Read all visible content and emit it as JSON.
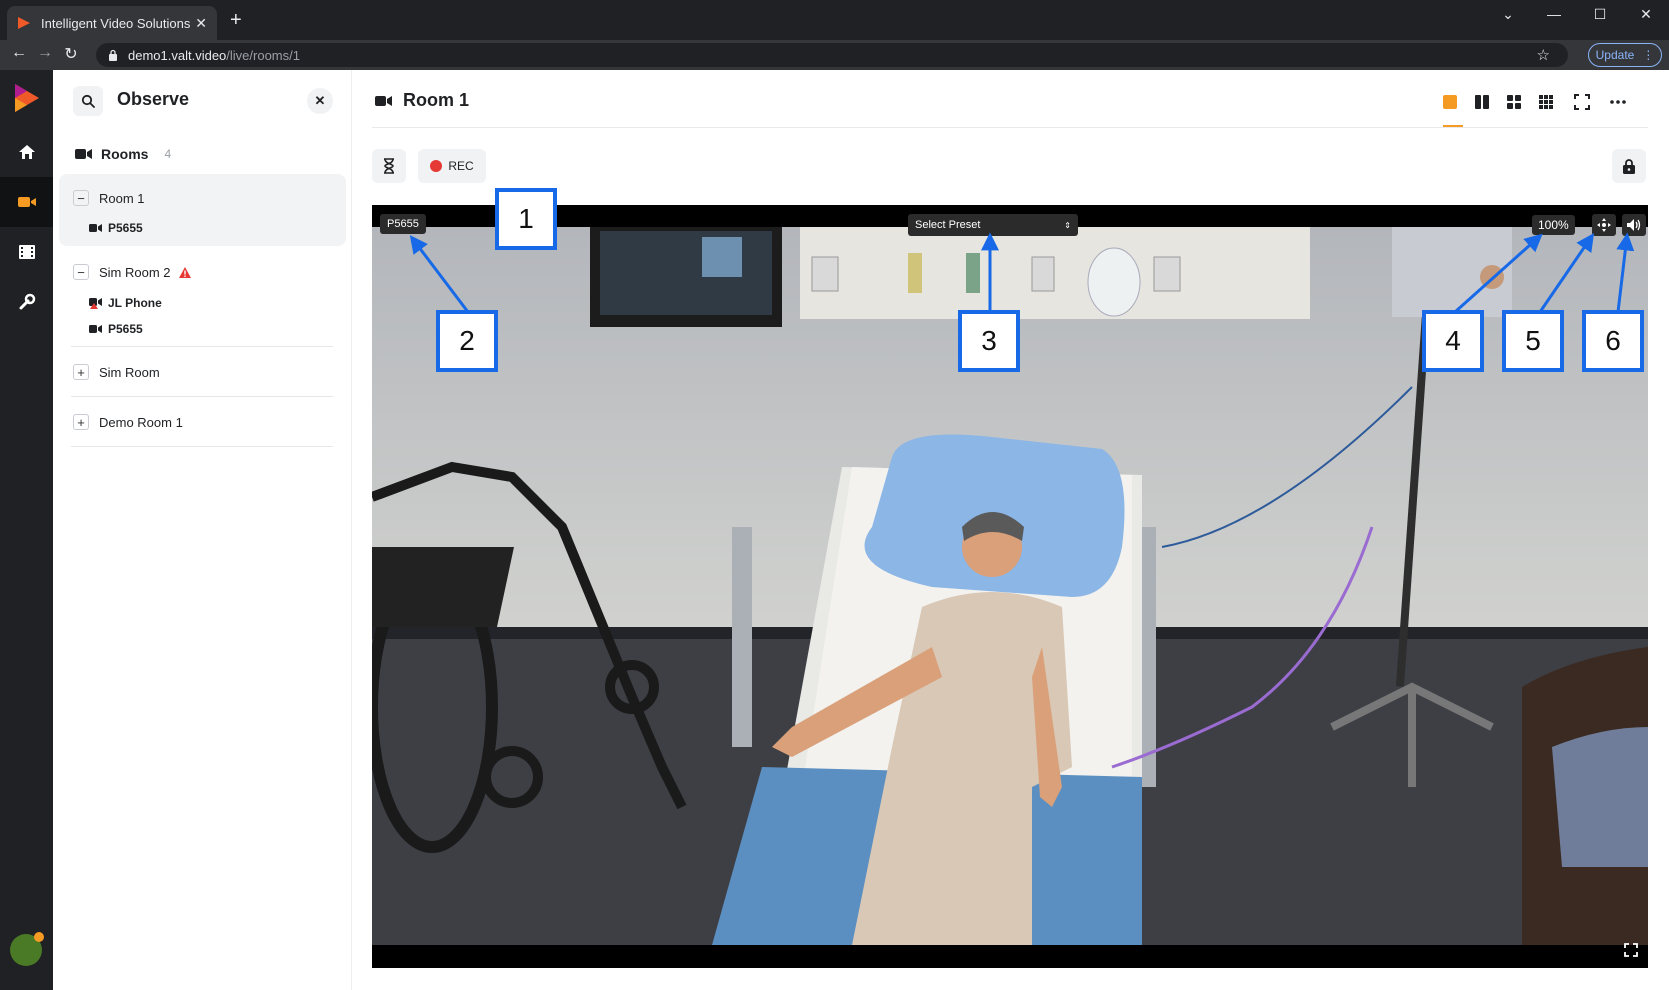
{
  "browser": {
    "tab_title": "Intelligent Video Solutions",
    "tab_close": "✕",
    "new_tab": "+",
    "url_host": "demo1.valt.video",
    "url_path": "/live/rooms/1",
    "update_label": "Update",
    "window_controls": [
      "⌄",
      "—",
      "☐",
      "✕"
    ]
  },
  "panel": {
    "title": "Observe",
    "rooms_label": "Rooms",
    "rooms_count": "4",
    "groups": [
      {
        "name": "Room 1",
        "toggle": "−",
        "cameras": [
          "P5655"
        ]
      },
      {
        "name": "Sim Room 2",
        "toggle": "−",
        "cameras": [
          "JL Phone",
          "P5655"
        ]
      },
      {
        "name": "Sim Room",
        "toggle": "+",
        "cameras": []
      },
      {
        "name": "Demo Room 1",
        "toggle": "+",
        "cameras": []
      }
    ]
  },
  "main": {
    "title": "Room 1",
    "rec_label": "REC",
    "video": {
      "camera_label": "P5655",
      "preset_label": "Select Preset",
      "zoom_level": "100%"
    }
  },
  "callouts": [
    "1",
    "2",
    "3",
    "4",
    "5",
    "6"
  ],
  "colors": {
    "accent": "#f59a23",
    "rail_bg": "#1f2124",
    "callout_blue": "#1769e8",
    "rec_red": "#e53935"
  },
  "icons": {
    "search": "search-icon",
    "home": "home-icon",
    "camera": "video-camera-icon",
    "film": "film-icon",
    "wrench": "wrench-icon",
    "lock": "lock-icon",
    "hourglass": "hourglass-icon",
    "ptz": "ptz-move-icon",
    "audio": "speaker-icon",
    "fullscreen": "fullscreen-icon"
  }
}
